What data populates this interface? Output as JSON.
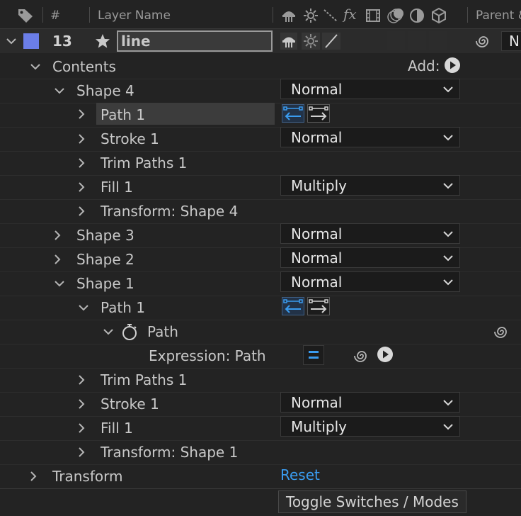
{
  "header": {
    "hash": "#",
    "layer_name": "Layer Name",
    "parent": "Parent &"
  },
  "layer": {
    "number": "13",
    "name": "line",
    "label_color": "#6b7ee8",
    "parent_value": "N"
  },
  "contents": {
    "label": "Contents",
    "add_label": "Add:"
  },
  "tree": [
    {
      "label": "Shape 4",
      "mode": "Normal"
    },
    {
      "label": "Path 1"
    },
    {
      "label": "Stroke 1",
      "mode": "Normal"
    },
    {
      "label": "Trim Paths 1"
    },
    {
      "label": "Fill 1",
      "mode": "Multiply"
    },
    {
      "label": "Transform: Shape 4"
    },
    {
      "label": "Shape 3",
      "mode": "Normal"
    },
    {
      "label": "Shape 2",
      "mode": "Normal"
    },
    {
      "label": "Shape 1",
      "mode": "Normal"
    },
    {
      "label": "Path 1"
    },
    {
      "label": "Path"
    },
    {
      "label": "Expression: Path"
    },
    {
      "label": "Trim Paths 1"
    },
    {
      "label": "Stroke 1",
      "mode": "Normal"
    },
    {
      "label": "Fill 1",
      "mode": "Multiply"
    },
    {
      "label": "Transform: Shape 1"
    }
  ],
  "transform": {
    "label": "Transform",
    "reset": "Reset"
  },
  "footer": {
    "toggle_label": "Toggle Switches / Modes"
  },
  "colors": {
    "background": "#232323",
    "text": "#d2d2d2",
    "accent_blue": "#3a9cf0",
    "highlight_row": "#3a3a3a"
  }
}
